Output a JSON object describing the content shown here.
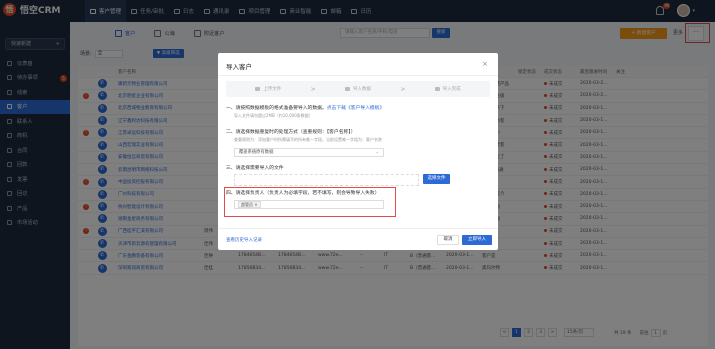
{
  "app": {
    "logo_letter": "悟",
    "name": "悟空CRM"
  },
  "nav": [
    {
      "label": "客户管理"
    },
    {
      "label": "任务/审批"
    },
    {
      "label": "日志"
    },
    {
      "label": "通讯录"
    },
    {
      "label": "项目管理"
    },
    {
      "label": "商业智能"
    },
    {
      "label": "邮箱"
    },
    {
      "label": "日历"
    }
  ],
  "top_right": {
    "notification_count": "99"
  },
  "sidebar": {
    "quick_create": "快速新建",
    "items": [
      {
        "label": "仪表盘"
      },
      {
        "label": "待办事项",
        "badge": "5"
      },
      {
        "label": "线索"
      },
      {
        "label": "客户"
      },
      {
        "label": "联系人"
      },
      {
        "label": "商机"
      },
      {
        "label": "合同"
      },
      {
        "label": "回款"
      },
      {
        "label": "发票"
      },
      {
        "label": "回访"
      },
      {
        "label": "产品"
      },
      {
        "label": "市场活动"
      }
    ]
  },
  "main": {
    "tabs": [
      {
        "label": "客户"
      },
      {
        "label": "公海"
      },
      {
        "label": "附近客户"
      }
    ],
    "search_placeholder": "请输入客户名称/手机/电话",
    "search_btn": "搜索",
    "new_btn": "+ 新建客户",
    "more_label": "更多",
    "dots": "···",
    "filter_label": "场景:",
    "filter_value": "全",
    "adv_filter": "▼ 高级筛选",
    "columns": [
      "客户名称",
      "客户级别",
      "成交状态",
      "下次联系时间",
      "备注",
      "锁定状态",
      "成交状态",
      "最后跟进时间",
      "关注"
    ],
    "rows": [
      {
        "warn": "",
        "name": "康新元物业管理有限公司",
        "contact": "",
        "tel": "",
        "mob": "",
        "site": "",
        "x": "",
        "src": "",
        "level": "",
        "time": "2020-03-0...",
        "note": "终端直营产品",
        "hold": "",
        "stat": "未成交",
        "date": "2020-03-2..."
      },
      {
        "warn": "!",
        "name": "北京明星企业有限公司",
        "contact": "",
        "tel": "",
        "mob": "",
        "site": "",
        "x": "",
        "src": "",
        "level": "",
        "time": "2020-03-0...",
        "note": "需要企业级",
        "hold": "",
        "stat": "未成交",
        "date": "2020-03-2..."
      },
      {
        "warn": "",
        "name": "北京西城物业教育有限公司",
        "contact": "",
        "tel": "",
        "mob": "",
        "site": "",
        "x": "",
        "src": "",
        "level": "",
        "time": "2020-03-0...",
        "note": "需要联系下",
        "hold": "",
        "stat": "未成交",
        "date": "2020-03-1..."
      },
      {
        "warn": "",
        "name": "辽宁鑫利达科技有限公司",
        "contact": "",
        "tel": "",
        "mob": "",
        "site": "",
        "x": "",
        "src": "",
        "level": "",
        "time": "2020-03-1...",
        "note": "电话回访客",
        "hold": "",
        "stat": "未成交",
        "date": "2020-03-1..."
      },
      {
        "warn": "!",
        "name": "江苏卓远科技有限公司",
        "contact": "",
        "tel": "",
        "mob": "",
        "site": "",
        "x": "",
        "src": "",
        "level": "",
        "time": "2020-03-1...",
        "note": "联系客户",
        "hold": "",
        "stat": "未成交",
        "date": "2020-03-1..."
      },
      {
        "warn": "",
        "name": "山西宏瑞实业有限公司",
        "contact": "",
        "tel": "",
        "mob": "",
        "site": "",
        "x": "",
        "src": "",
        "level": "",
        "time": "2020-03-1...",
        "note": "电话方式客",
        "hold": "",
        "stat": "未成交",
        "date": "2020-03-1..."
      },
      {
        "warn": "",
        "name": "安徽恒信商贸有限公司",
        "contact": "",
        "tel": "",
        "mob": "",
        "site": "",
        "x": "",
        "src": "",
        "level": "",
        "time": "2020-03-1...",
        "note": "推广广告了",
        "hold": "",
        "stat": "未成交",
        "date": "2020-03-1..."
      },
      {
        "warn": "",
        "name": "云南昆明市网络科技公司",
        "contact": "",
        "tel": "",
        "mob": "",
        "site": "",
        "x": "",
        "src": "",
        "level": "",
        "time": "2020-03-1...",
        "note": "通过Q沟通",
        "hold": "",
        "stat": "未成交",
        "date": "2020-03-1..."
      },
      {
        "warn": "!",
        "name": "中国投资控股有限公司",
        "contact": "",
        "tel": "",
        "mob": "",
        "site": "",
        "x": "",
        "src": "",
        "level": "",
        "time": "--",
        "note": "--",
        "hold": "",
        "stat": "未成交",
        "date": "2020-03-1..."
      },
      {
        "warn": "",
        "name": "广州科技有限公司",
        "contact": "",
        "tel": "",
        "mob": "",
        "site": "",
        "x": "",
        "src": "",
        "level": "",
        "time": "2020-03-1...",
        "note": "通过朋友介",
        "hold": "",
        "stat": "未成交",
        "date": "2020-03-1..."
      },
      {
        "warn": "!",
        "name": "杭州智能设计有限公司",
        "contact": "",
        "tel": "",
        "mob": "",
        "site": "",
        "x": "",
        "src": "",
        "level": "",
        "time": "2020-03-1...",
        "note": "网站咨询",
        "hold": "",
        "stat": "未成交",
        "date": "2020-03-1..."
      },
      {
        "warn": "",
        "name": "湖南金星商务有限公司",
        "contact": "",
        "tel": "",
        "mob": "",
        "site": "",
        "x": "",
        "src": "",
        "level": "",
        "time": "2020-03-1...",
        "note": "电话咨询",
        "hold": "",
        "stat": "未成交",
        "date": "2020-03-1..."
      },
      {
        "warn": "!",
        "name": "广西桂平汇溪有限公司",
        "contact": "周伟",
        "tel": "1785642621...",
        "mob": "1785642621...",
        "site": "www.72e...",
        "x": "--",
        "src": "其他",
        "level": "A（重要客...",
        "time": "2020-03-1...",
        "note": "--",
        "hold": "",
        "stat": "未成交",
        "date": "2020-03-1..."
      },
      {
        "warn": "",
        "name": "天津市新云源农管理有限公司",
        "contact": "佳伟",
        "tel": "1785642541...",
        "mob": "1785642541...",
        "site": "www.72e...",
        "x": "--",
        "src": "商业服务",
        "level": "B（普通客...",
        "time": "2020-03-1...",
        "note": "客户是",
        "hold": "",
        "stat": "未成交",
        "date": "2020-03-1..."
      },
      {
        "warn": "",
        "name": "广东金鹏装备有限公司",
        "contact": "佳钟",
        "tel": "1784654B...",
        "mob": "1784654B...",
        "site": "www.72e...",
        "x": "--",
        "src": "IT",
        "level": "B（普通客...",
        "time": "2020-03-1...",
        "note": "客户是",
        "hold": "",
        "stat": "未成交",
        "date": "2020-03-1..."
      },
      {
        "warn": "",
        "name": "深圳家润商贸有限公司",
        "contact": "佳桂",
        "tel": "17856B34...",
        "mob": "17856B34...",
        "site": "www.72e...",
        "x": "--",
        "src": "IT",
        "level": "B（普通客...",
        "time": "2020-03-1...",
        "note": "奥玛尔特",
        "hold": "",
        "stat": "未成交",
        "date": "2020-03-1..."
      }
    ],
    "pager": {
      "prev": "<",
      "pages": [
        "1",
        "2",
        "3"
      ],
      "next": ">",
      "size": "15条/页",
      "total": "共 19 条",
      "goto_label": "前往",
      "goto_value": "1",
      "goto_unit": "页"
    }
  },
  "dialog": {
    "title": "导入客户",
    "close": "×",
    "steps": [
      {
        "label": "上传文件"
      },
      {
        "label": "导入数据"
      },
      {
        "label": "导入完成"
      }
    ],
    "step_sep": ">",
    "sec1_title": "一、请按照数据模板的格式准备要导入的数据。",
    "sec1_link": "点击下载《客户导入模板》",
    "sec1_sub": "导入文件请勿超过2MB（约10,000条数据）",
    "sec2_title": "二、请选择数据重复时的处理方式（查重规则：【客户名称】）",
    "sec2_sub": "查重规则为：添加客户时所需填写的所有唯一字段，当前设置唯一字段为：客户名称",
    "sec2_value": "覆盖系统原有数据",
    "sec3_title": "三、请选择需要导入的文件",
    "sel_file_btn": "选择文件",
    "sec4_title": "四、请选择负责人（负责人为必填字段，若不填写，则会导致导入失败）",
    "sec4_tag": "超管员 ×",
    "hist_link": "查看历史导入记录",
    "cancel": "取消",
    "import": "立即导入"
  }
}
